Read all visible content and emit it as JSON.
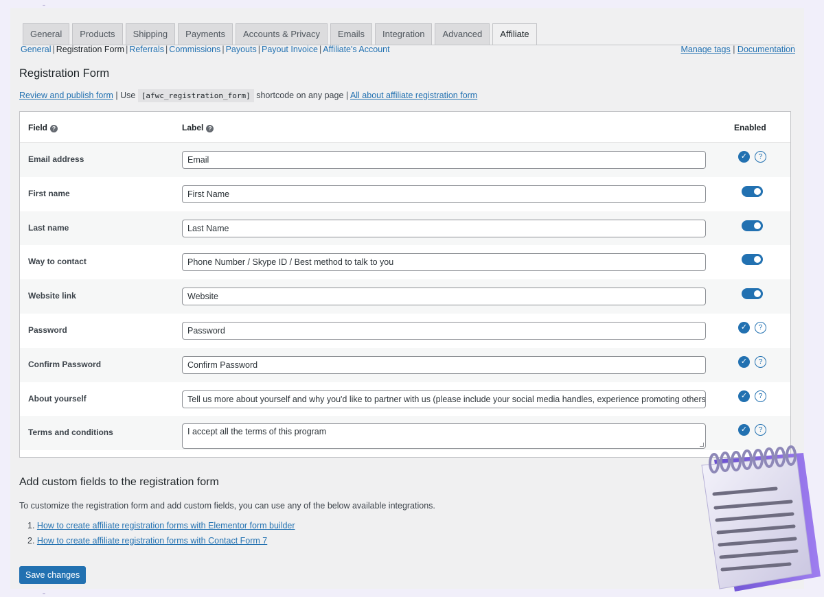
{
  "tabs": [
    "General",
    "Products",
    "Shipping",
    "Payments",
    "Accounts & Privacy",
    "Emails",
    "Integration",
    "Advanced",
    "Affiliate"
  ],
  "active_tab": "Affiliate",
  "subnav": {
    "items": [
      "General",
      "Registration Form",
      "Referrals",
      "Commissions",
      "Payouts",
      "Payout Invoice",
      "Affiliate's Account"
    ],
    "current": "Registration Form"
  },
  "top_links": {
    "manage_tags": "Manage tags",
    "documentation": "Documentation"
  },
  "page_title": "Registration Form",
  "intro": {
    "review_link": "Review and publish form",
    "use_text": "| Use",
    "shortcode": "[afwc_registration_form]",
    "shortcode_text": "shortcode on any page |",
    "about_link": "All about affiliate registration form"
  },
  "table": {
    "headers": {
      "field": "Field",
      "label": "Label",
      "enabled": "Enabled"
    },
    "rows": [
      {
        "field": "Email address",
        "label": "Email",
        "control": "check"
      },
      {
        "field": "First name",
        "label": "First Name",
        "control": "toggle"
      },
      {
        "field": "Last name",
        "label": "Last Name",
        "control": "toggle"
      },
      {
        "field": "Way to contact",
        "label": "Phone Number / Skype ID / Best method to talk to you",
        "control": "toggle"
      },
      {
        "field": "Website link",
        "label": "Website",
        "control": "toggle"
      },
      {
        "field": "Password",
        "label": "Password",
        "control": "check"
      },
      {
        "field": "Confirm Password",
        "label": "Confirm Password",
        "control": "check"
      },
      {
        "field": "About yourself",
        "label": "Tell us more about yourself and why you'd like to partner with us (please include your social media handles, experience promoting others, tell",
        "control": "check"
      },
      {
        "field": "Terms and conditions",
        "label": "I accept all the terms of this program",
        "control": "check"
      }
    ]
  },
  "custom_section": {
    "title": "Add custom fields to the registration form",
    "description": "To customize the registration form and add custom fields, you can use any of the below available integrations.",
    "links": [
      {
        "num": "1.",
        "text": "How to create affiliate registration forms with Elementor form builder"
      },
      {
        "num": "2.",
        "text": "How to create affiliate registration forms with Contact Form 7"
      }
    ]
  },
  "save_button": "Save changes",
  "colors": {
    "accent": "#2271b1",
    "panel": "#f0f0f1",
    "backdrop": "#f1effa",
    "notepad_spiral": "#7b5cd6"
  },
  "icons": {
    "help": "question-circle-icon",
    "enabled": "check-circle-icon",
    "decor": "notepad-illustration"
  }
}
